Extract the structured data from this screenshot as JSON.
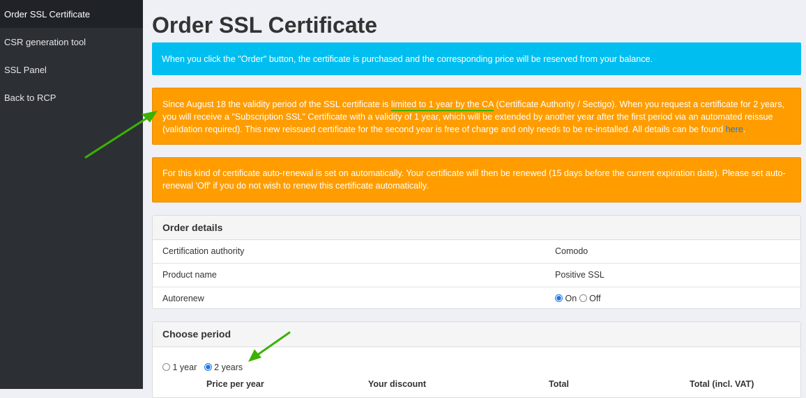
{
  "sidebar": {
    "items": [
      {
        "label": "Order SSL Certificate"
      },
      {
        "label": "CSR generation tool"
      },
      {
        "label": "SSL Panel"
      },
      {
        "label": "Back to RCP"
      }
    ]
  },
  "page": {
    "title": "Order SSL Certificate"
  },
  "alerts": {
    "info": "When you click the \"Order\" button, the certificate is purchased and the corresponding price will be reserved from your balance.",
    "validity": {
      "before": "Since August 18 the validity period of the SSL certificate is ",
      "highlight": "limited to 1 year by the CA",
      "after": " (Certificate Authority / Sectigo). When you request a certificate for 2 years, you will receive a \"Subscription SSL\" Certificate with a validity of 1 year, which will be extended by another year after the first period via an automated reissue (validation required). This new reissued certificate for the second year is free of charge and only needs to be re-installed. All details can be found ",
      "link": "here",
      "end": "."
    },
    "autorenew": "For this kind of certificate auto-renewal is set on automatically. Your certificate will then be renewed (15 days before the current expiration date). Please set auto-renewal 'Off' if you do not wish to renew this certificate automatically."
  },
  "order_details": {
    "heading": "Order details",
    "rows": [
      {
        "label": "Certification authority",
        "value": "Comodo"
      },
      {
        "label": "Product name",
        "value": "Positive SSL"
      }
    ],
    "autorenew": {
      "label": "Autorenew",
      "on": "On",
      "off": "Off",
      "selected": "On"
    }
  },
  "choose_period": {
    "heading": "Choose period",
    "options": [
      "1 year",
      "2 years"
    ],
    "selected": "2 years",
    "columns": [
      "Price per year",
      "Your discount",
      "Total",
      "Total (incl. VAT)"
    ]
  },
  "colors": {
    "info": "#00bff0",
    "warning": "#ff9d00",
    "annotation": "#3bb100",
    "sidebar": "#2c3035"
  }
}
